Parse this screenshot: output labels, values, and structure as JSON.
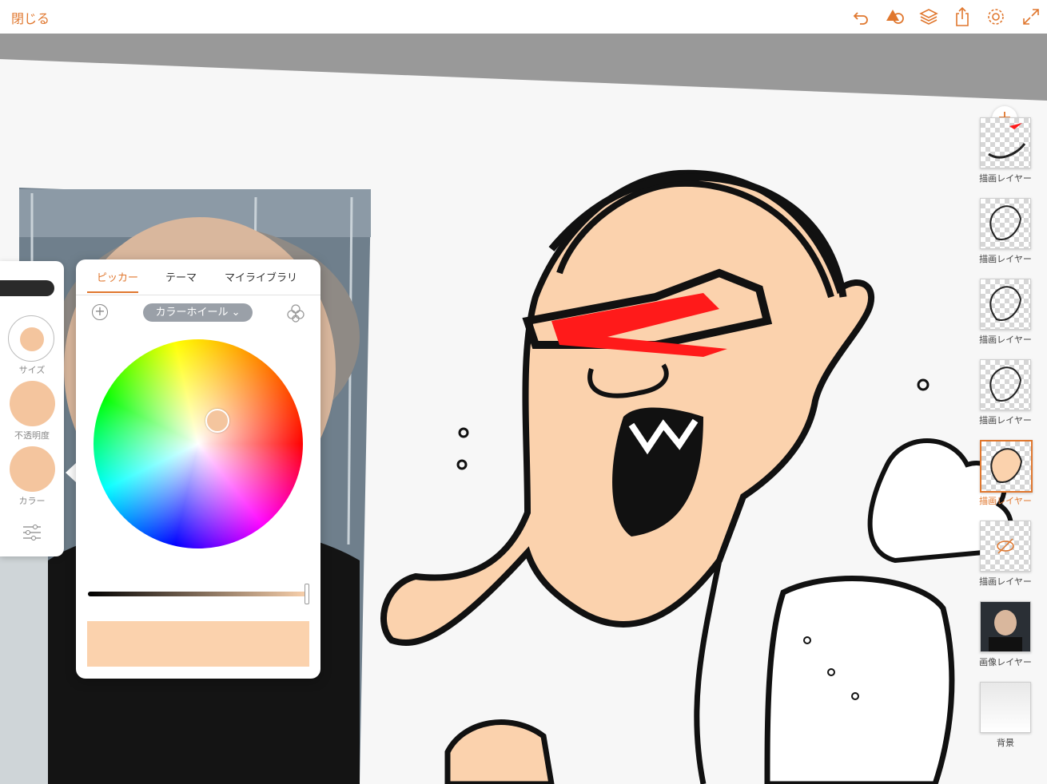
{
  "topbar": {
    "close_label": "閉じる",
    "icons": [
      "undo-icon",
      "shapes-icon",
      "layers-icon",
      "share-icon",
      "gear-icon",
      "fullscreen-icon"
    ]
  },
  "layers_panel": {
    "add_label": "+",
    "layers": [
      {
        "label": "描画レイヤー",
        "selected": false
      },
      {
        "label": "描画レイヤー",
        "selected": false
      },
      {
        "label": "描画レイヤー",
        "selected": false
      },
      {
        "label": "描画レイヤー",
        "selected": false
      },
      {
        "label": "描画レイヤー",
        "selected": true
      },
      {
        "label": "描画レイヤー",
        "selected": false,
        "hidden": true
      },
      {
        "label": "画像レイヤー",
        "selected": false
      },
      {
        "label": "背景",
        "selected": false
      }
    ]
  },
  "tool_side": {
    "size_label": "サイズ",
    "opacity_label": "不透明度",
    "color_label": "カラー",
    "current_color": "#f4c59e"
  },
  "color_picker": {
    "tabs": [
      "ピッカー",
      "テーマ",
      "マイライブラリ"
    ],
    "active_tab": 0,
    "mode": "カラーホイール",
    "selected_color": "#fbd2ad"
  },
  "colors": {
    "accent": "#e0772e",
    "skin": "#fbd2ad",
    "red_mark": "#ff1a1a"
  }
}
